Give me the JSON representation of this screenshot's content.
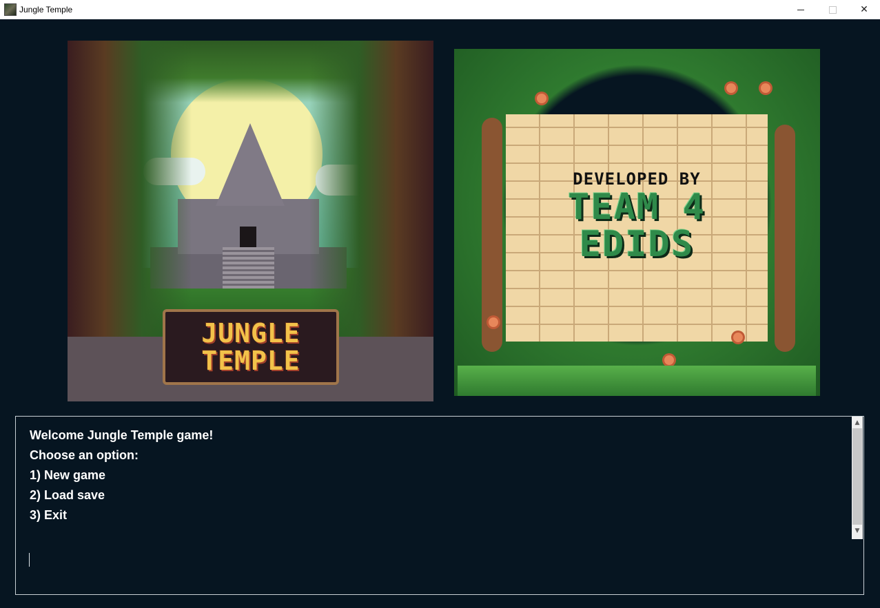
{
  "window": {
    "title": "Jungle Temple",
    "minimize_glyph": "—",
    "maximize_glyph": "☐",
    "close_glyph": "✕"
  },
  "title_art": {
    "logo_line1": "JUNGLE",
    "logo_line2": "TEMPLE"
  },
  "credits_art": {
    "line1": "DEVELOPED BY",
    "line2": "TEAM 4",
    "line3": "EDIDS"
  },
  "console": {
    "lines": [
      "Welcome Jungle Temple game!",
      "Choose an option:",
      "1) New game",
      "2) Load save",
      "3) Exit"
    ],
    "input_value": ""
  },
  "colors": {
    "background": "#061521",
    "console_text": "#ffffff",
    "console_border": "#c9d1d6"
  },
  "icons": {
    "app": "jungle-temple-app-icon",
    "scroll_up": "chevron-up-icon",
    "scroll_down": "chevron-down-icon"
  }
}
